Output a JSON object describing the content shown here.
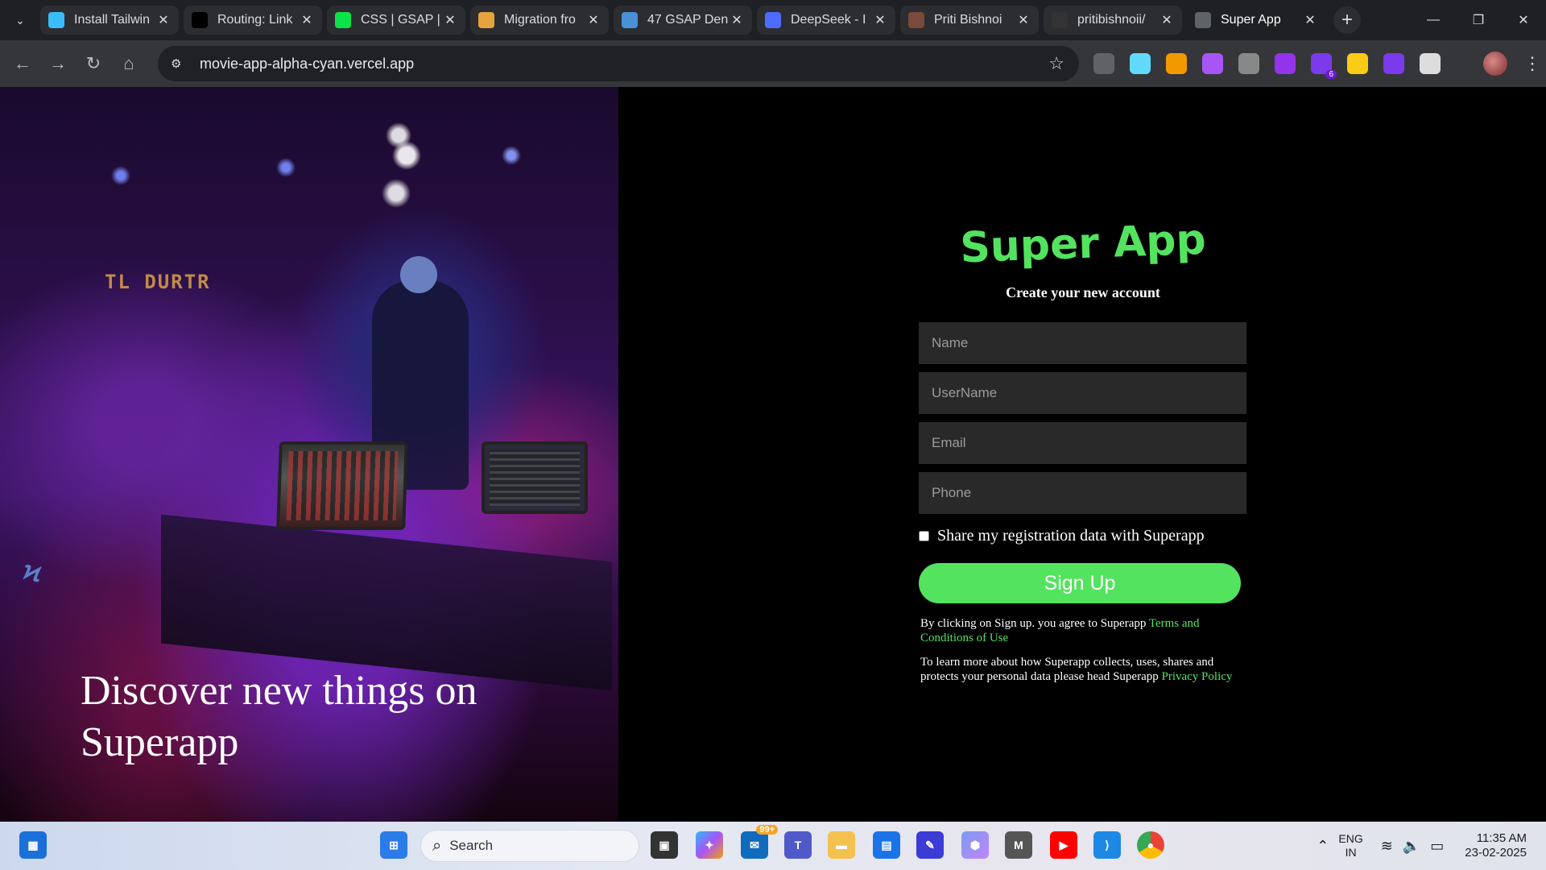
{
  "browser": {
    "tabs": [
      {
        "title": "Install Tailwin",
        "favicon": "tailwind-icon",
        "color": "#38bdf8"
      },
      {
        "title": "Routing: Link",
        "favicon": "nextjs-icon",
        "color": "#000000"
      },
      {
        "title": "CSS | GSAP | I",
        "favicon": "gsap-icon",
        "color": "#0ae448"
      },
      {
        "title": "Migration fro",
        "favicon": "migration-icon",
        "color": "#e7a33e"
      },
      {
        "title": "47 GSAP Den",
        "favicon": "codepen-icon",
        "color": "#4a90d9"
      },
      {
        "title": "DeepSeek - I",
        "favicon": "deepseek-icon",
        "color": "#4d6bfe"
      },
      {
        "title": "Priti Bishnoi",
        "favicon": "linkedin-avatar-icon",
        "color": "#7a4a3a"
      },
      {
        "title": "pritibishnoii/",
        "favicon": "github-icon",
        "color": "#333333"
      },
      {
        "title": "Super App",
        "favicon": "globe-icon",
        "color": "#5f6368",
        "active": true
      }
    ],
    "url": "movie-app-alpha-cyan.vercel.app",
    "extensions": [
      {
        "name": "camera-icon",
        "color": "#5f6368"
      },
      {
        "name": "react-icon",
        "color": "#61dafb"
      },
      {
        "name": "pen-icon",
        "color": "#f29900"
      },
      {
        "name": "redux-icon",
        "color": "#a855f7"
      },
      {
        "name": "target-icon",
        "color": "#888888"
      },
      {
        "name": "gear-icon",
        "color": "#9333ea"
      },
      {
        "name": "puzzle-badge-icon",
        "color": "#7c3aed",
        "badge": "6"
      },
      {
        "name": "ruler-icon",
        "color": "#facc15"
      },
      {
        "name": "color-wheel-icon",
        "color": "#7c3aed"
      },
      {
        "name": "extensions-icon",
        "color": "#dddddd"
      }
    ]
  },
  "hero": {
    "caption": "Discover new things on Superapp",
    "sign_text": "TL DURTR"
  },
  "form": {
    "app_title": "Super App",
    "subtitle": "Create your new account",
    "fields": {
      "name": "Name",
      "username": "UserName",
      "email": "Email",
      "phone": "Phone"
    },
    "consent_label": "Share my registration data with Superapp",
    "submit_label": "Sign Up",
    "terms_text": "By clicking on Sign up. you agree to Superapp ",
    "terms_link": "Terms and Conditions of Use",
    "privacy_text": "To learn more about how Superapp collects, uses, shares and protects your personal data please head Superapp ",
    "privacy_link": "Privacy Policy",
    "accent_color": "#53e35f"
  },
  "taskbar": {
    "search_label": "Search",
    "mail_badge": "99+",
    "language": "ENG",
    "region": "IN",
    "time": "11:35 AM",
    "date": "23-02-2025"
  }
}
